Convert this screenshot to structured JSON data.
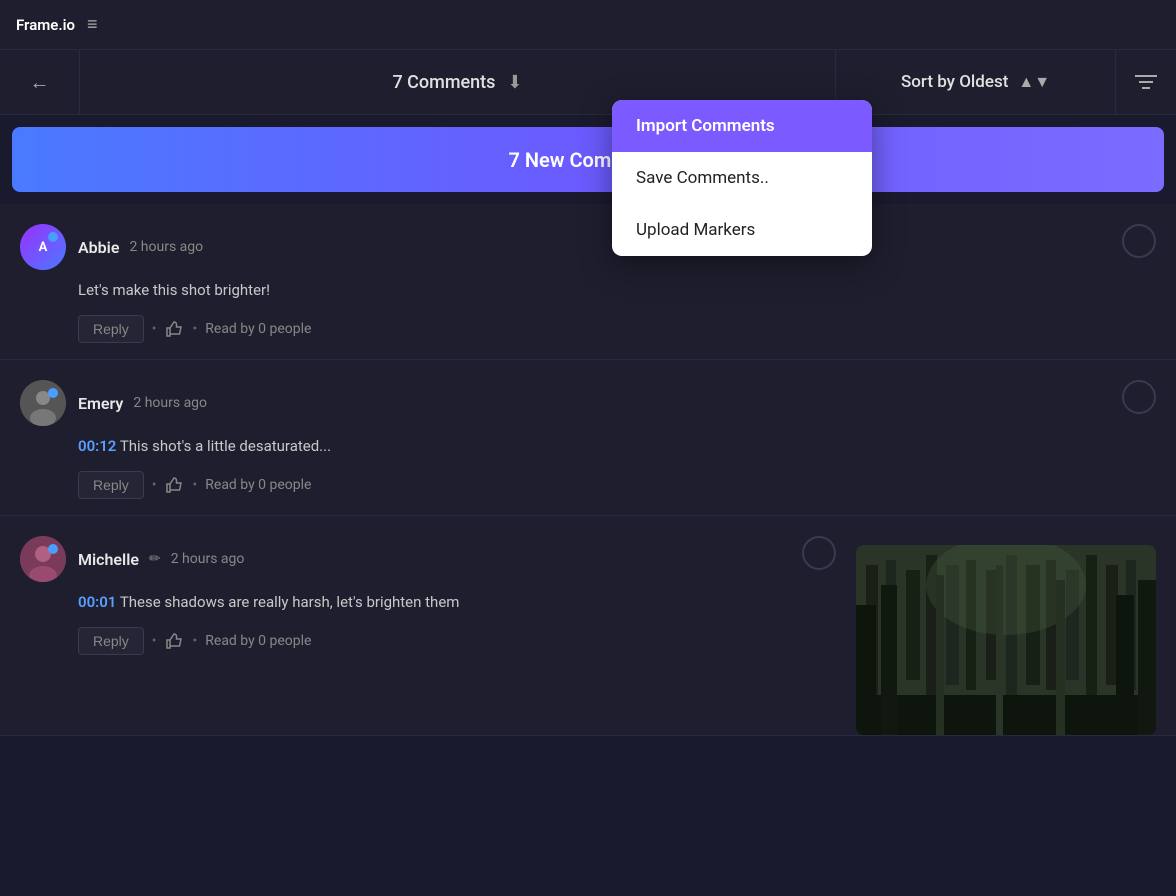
{
  "app": {
    "title": "Frame.io",
    "menu_icon": "≡"
  },
  "header": {
    "back_icon": "←",
    "comments_count": "7 Comments",
    "download_icon": "⬇",
    "sort_label": "Sort by Oldest",
    "sort_arrow": "▲▼",
    "filter_icon": "⊟"
  },
  "banner": {
    "text": "7 New Comments"
  },
  "dropdown": {
    "items": [
      {
        "label": "Import Comments",
        "active": true
      },
      {
        "label": "Save Comments..",
        "active": false
      },
      {
        "label": "Upload Markers",
        "active": false
      }
    ]
  },
  "comments": [
    {
      "author": "Abbie",
      "time": "2 hours ago",
      "body": "Let's make this shot brighter!",
      "timestamp": null,
      "reply_label": "Reply",
      "read_label": "Read by 0 people",
      "has_thumbnail": false
    },
    {
      "author": "Emery",
      "time": "2 hours ago",
      "body": "This shot's a little desaturated...",
      "timestamp": "00:12",
      "reply_label": "Reply",
      "read_label": "Read by 0 people",
      "has_thumbnail": false
    },
    {
      "author": "Michelle",
      "time": "2 hours ago",
      "body": "These shadows are really harsh, let's brighten them",
      "timestamp": "00:01",
      "reply_label": "Reply",
      "read_label": "Read by 0 people",
      "has_thumbnail": true
    }
  ]
}
